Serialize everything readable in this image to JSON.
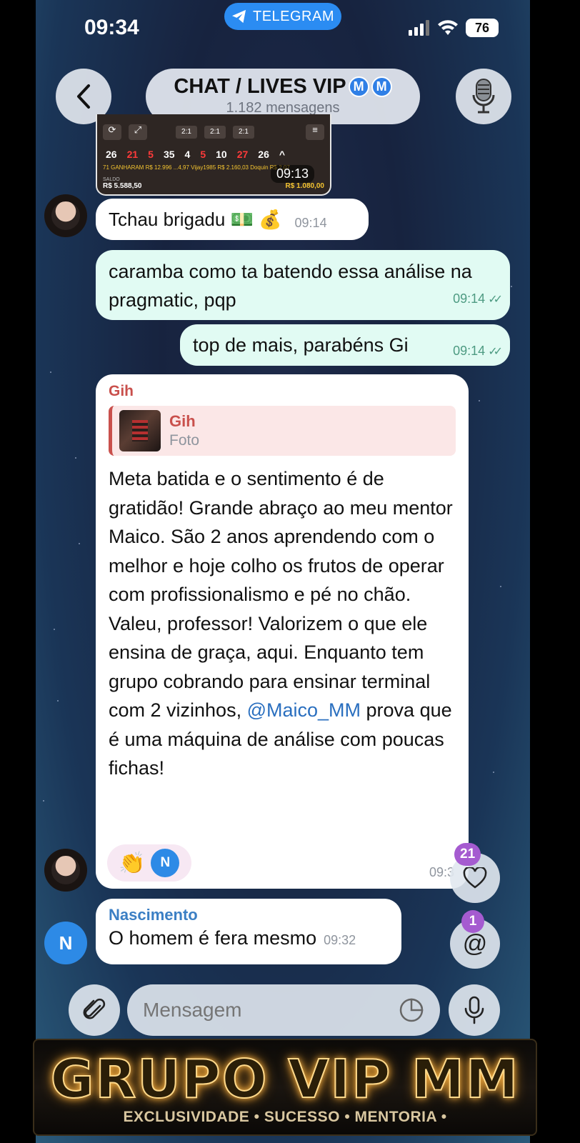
{
  "status_bar": {
    "time": "09:34",
    "app_pill": "TELEGRAM",
    "battery": "76"
  },
  "header": {
    "title": "CHAT / LIVES VIP",
    "title_badges": [
      "M",
      "M"
    ],
    "subtitle": "1.182 mensagens"
  },
  "thumbnail": {
    "chips": [
      "2:1",
      "2:1",
      "2:1"
    ],
    "numbers": [
      "26",
      "21",
      "5",
      "35",
      "4",
      "5",
      "10",
      "27",
      "26"
    ],
    "stats": "71 GANHARAM R$ 12.996 ...4,97 Vijay1985 R$ 2.160,03 Doquin R$ 2,07",
    "saldo_label": "SALDO",
    "saldo_value": "R$ 5.588,50",
    "right_value": "R$ 1.080,00",
    "time": "09:13"
  },
  "messages": [
    {
      "text": "Tchau brigadu 💵 💰",
      "time": "09:14"
    },
    {
      "text": "caramba como ta batendo essa análise na pragmatic, pqp",
      "time": "09:14"
    },
    {
      "text": "top de mais, parabéns Gi",
      "time": "09:14"
    },
    {
      "sender": "Gih",
      "reply_name": "Gih",
      "reply_sub": "Foto",
      "text_before": "Meta batida e o sentimento é de gratidão! Grande abraço ao meu mentor Maico. São 2 anos aprendendo com o melhor e hoje colho os frutos de operar com profissionalismo e pé no chão. Valeu, professor! Valorizem o que ele ensina de graça, aqui. Enquanto tem grupo cobrando para ensinar terminal com 2 vizinhos,",
      "mention": "@Maico_MM",
      "text_after": " prova que é uma máquina de análise com poucas fichas!",
      "reaction_emoji": "👏",
      "reaction_user": "N",
      "time": "09:3"
    },
    {
      "sender": "Nascimento",
      "avatar": "N",
      "text": "O homem é fera mesmo",
      "time": "09:32"
    }
  ],
  "fabs": {
    "reactions_count": "21",
    "mentions_count": "1"
  },
  "composer": {
    "placeholder": "Mensagem"
  },
  "banner": {
    "title": "GRUPO VIP MM",
    "tagline": "EXCLUSIVIDADE • SUCESSO • MENTORIA •"
  },
  "colors": {
    "telegram_blue": "#2b8cf2",
    "outgoing_bubble": "#e1fbf3",
    "gih_name": "#c9504c",
    "nascimento_name": "#3b7fc4",
    "badge_purple": "#a55bd0"
  }
}
